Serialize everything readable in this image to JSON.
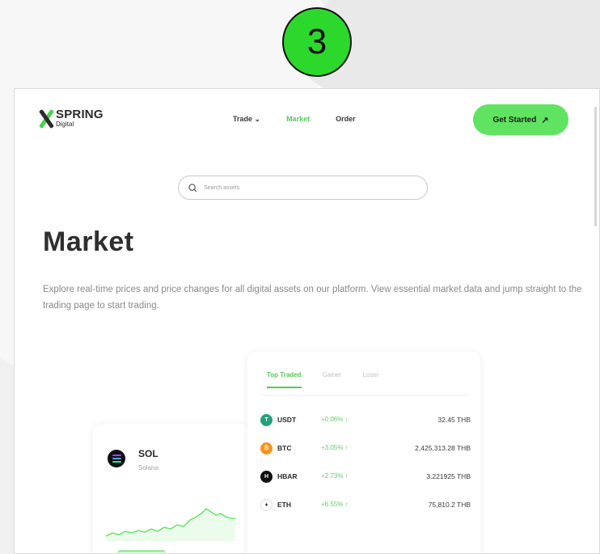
{
  "step_badge": "3",
  "header": {
    "logo": {
      "brand": "SPRING",
      "sub": "Digital"
    },
    "nav": [
      {
        "label": "Trade ⌄"
      },
      {
        "label": "Market"
      },
      {
        "label": "Order"
      }
    ],
    "cta_label": "Get Started",
    "cta_icon": "arrow-up-right-icon"
  },
  "search": {
    "placeholder": "Search assets"
  },
  "hero": {
    "title": "Market",
    "description": "Explore real-time prices and price changes for all digital assets on our platform. View essential market data and jump straight to the trading page to start trading."
  },
  "featured": {
    "symbol": "SOL",
    "name": "Solana"
  },
  "market": {
    "tabs": [
      {
        "label": "Top Traded",
        "active": true
      },
      {
        "label": "Gainer",
        "active": false
      },
      {
        "label": "Loser",
        "active": false
      }
    ],
    "rows": [
      {
        "symbol": "USDT",
        "change": "+0.06% ↑",
        "price": "32.45 THB",
        "icon_color": "#26a17b",
        "icon_glyph": "T"
      },
      {
        "symbol": "BTC",
        "change": "+3.05% ↑",
        "price": "2,425,313.28 THB",
        "icon_color": "#f7931a",
        "icon_glyph": "₿"
      },
      {
        "symbol": "HBAR",
        "change": "+2.73% ↑",
        "price": "3.221925 THB",
        "icon_color": "#111111",
        "icon_glyph": "H"
      },
      {
        "symbol": "ETH",
        "change": "+6.55% ↑",
        "price": "75,810.2 THB",
        "icon_color": "#ffffff",
        "icon_glyph": "♦"
      }
    ]
  },
  "colors": {
    "accent": "#5fe360",
    "accent_text": "#58c85c",
    "badge": "#2dd82d"
  }
}
